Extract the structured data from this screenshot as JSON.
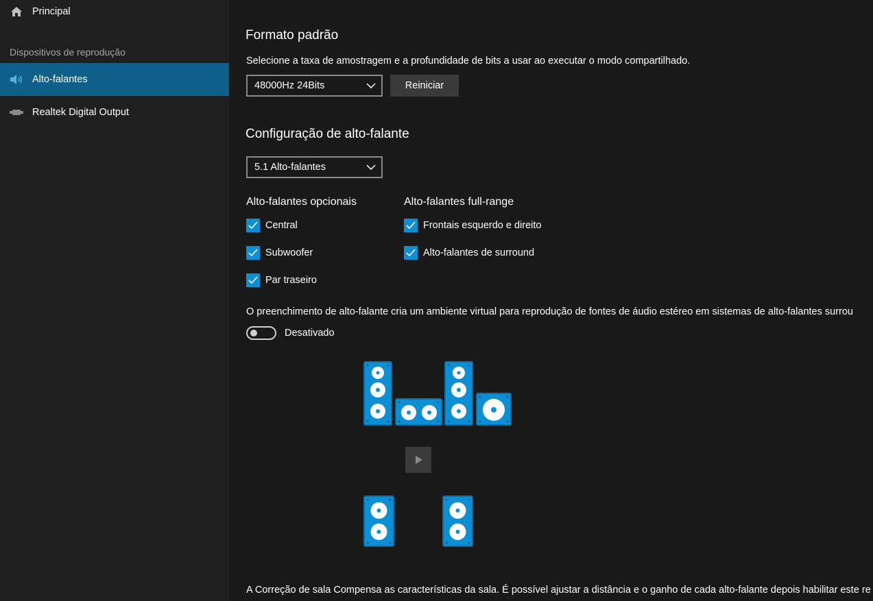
{
  "sidebar": {
    "home_label": "Principal",
    "section_label": "Dispositivos de reprodução",
    "items": [
      {
        "label": "Alto-falantes",
        "icon": "speaker-icon",
        "active": true
      },
      {
        "label": "Realtek Digital Output",
        "icon": "digital-output-icon",
        "active": false
      }
    ]
  },
  "format": {
    "title": "Formato padrão",
    "description": "Selecione a taxa de amostragem e a profundidade de bits a usar ao executar o modo compartilhado.",
    "selected": "48000Hz 24Bits",
    "reset_label": "Reiniciar"
  },
  "config": {
    "title": "Configuração de alto-falante",
    "selected": "5.1 Alto-falantes",
    "optional_title": "Alto-falantes opcionais",
    "optional": [
      {
        "label": "Central",
        "checked": true
      },
      {
        "label": "Subwoofer",
        "checked": true
      },
      {
        "label": "Par traseiro",
        "checked": true
      }
    ],
    "fullrange_title": "Alto-falantes full-range",
    "fullrange": [
      {
        "label": "Frontais esquerdo e direito",
        "checked": true
      },
      {
        "label": "Alto-falantes de surround",
        "checked": true
      }
    ]
  },
  "fill": {
    "description": "O preenchimento de alto-falante cria um ambiente virtual para reprodução de fontes de áudio estéreo em sistemas de alto-falantes surrou",
    "toggle_label": "Desativado",
    "toggle_on": false
  },
  "room": {
    "description": "A Correção de sala Compensa as características da sala. É possível ajustar a distância e o ganho de cada alto-falante depois habilitar este re"
  },
  "colors": {
    "accent": "#0e8fd4",
    "active_nav": "#0e5f8a",
    "background": "#191919",
    "sidebar": "#1f1f1f"
  }
}
